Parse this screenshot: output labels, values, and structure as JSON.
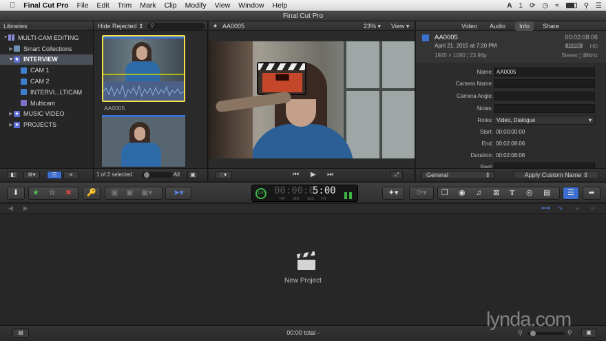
{
  "menubar": {
    "app_name": "Final Cut Pro",
    "items": [
      "File",
      "Edit",
      "Trim",
      "Mark",
      "Clip",
      "Modify",
      "View",
      "Window",
      "Help"
    ],
    "status_count": "1"
  },
  "window": {
    "title": "Final Cut Pro"
  },
  "libraries": {
    "header": "Libraries",
    "items": [
      {
        "label": "MULTI-CAM EDITING",
        "indent": 0
      },
      {
        "label": "Smart Collections",
        "indent": 1
      },
      {
        "label": "INTERVIEW",
        "indent": 1,
        "selected": true
      },
      {
        "label": "CAM 1",
        "indent": 2
      },
      {
        "label": "CAM 2",
        "indent": 2
      },
      {
        "label": "INTERVI...LTICAM",
        "indent": 2
      },
      {
        "label": "Multicam",
        "indent": 2
      },
      {
        "label": "MUSIC VIDEO",
        "indent": 1
      },
      {
        "label": "PROJECTS",
        "indent": 1
      }
    ]
  },
  "browser": {
    "filter_label": "Hide Rejected",
    "clips": [
      {
        "name": "AA0005"
      }
    ],
    "selection_status": "1 of 2 selected",
    "duration_filter": "All"
  },
  "viewer": {
    "clip_name": "AA0005",
    "zoom": "23%",
    "view_menu": "View"
  },
  "inspector": {
    "tabs": [
      "Video",
      "Audio",
      "Info",
      "Share"
    ],
    "active_tab": "Info",
    "clip_name": "AA0005",
    "duration_top": "00:02:08:06",
    "date": "April 21, 2015 at 7:20 PM",
    "format": "1920 × 1080 ¦ 23.98p",
    "badges": [
      "1080p",
      "HD"
    ],
    "audio": "Stereo ¦ 48kHz",
    "fields": {
      "name_label": "Name:",
      "name_value": "AA0005",
      "camera_name_label": "Camera Name:",
      "camera_angle_label": "Camera Angle:",
      "notes_label": "Notes:",
      "roles_label": "Roles:",
      "roles_value": "Video, Dialogue",
      "start_label": "Start:",
      "start_value": "00:00:00:00",
      "end_label": "End:",
      "end_value": "00:02:08:06",
      "duration_label": "Duration:",
      "duration_value": "00:02:08:06",
      "reel_label": "Reel:"
    },
    "metadata_view": "General",
    "apply_button": "Apply Custom Name"
  },
  "toolbar": {
    "timecode": "5:00",
    "tc_units": [
      "HR",
      "MIN",
      "SEC",
      "FR"
    ],
    "speed_badge": "100"
  },
  "timeline": {
    "empty_label": "New Project"
  },
  "status": {
    "total": "00:00 total -",
    "watermark": "lynda.com"
  },
  "colors": {
    "accent_blue": "#3d6fd1",
    "selection_yellow": "#f5e04a",
    "favorite_green": "#4ec34e",
    "reject_red": "#d94444"
  }
}
